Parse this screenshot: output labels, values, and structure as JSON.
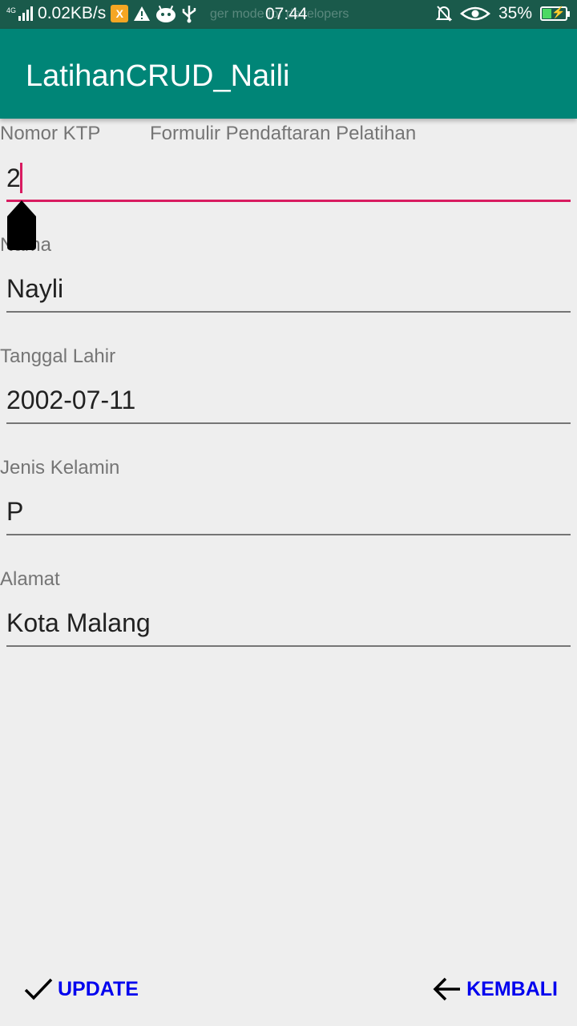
{
  "status_bar": {
    "network_type": "4G",
    "speed": "0.02KB/s",
    "ghost_text": "ger mode for developers",
    "time": "07:44",
    "battery": "35%",
    "battery_level": 0.35
  },
  "app_bar": {
    "title": "LatihanCRUD_Naili"
  },
  "form": {
    "title": "Formulir Pendaftaran Pelatihan",
    "fields": [
      {
        "label": "Nomor KTP",
        "value": "2"
      },
      {
        "label": "Nama",
        "value": "Nayli"
      },
      {
        "label": "Tanggal Lahir",
        "value": "2002-07-11"
      },
      {
        "label": "Jenis Kelamin",
        "value": "P"
      },
      {
        "label": "Alamat",
        "value": "Kota Malang"
      }
    ]
  },
  "buttons": {
    "update": {
      "label": "UPDATE",
      "icon": "check-icon"
    },
    "back": {
      "label": "KEMBALI",
      "icon": "arrow-left-icon"
    }
  },
  "colors": {
    "primary": "#008577",
    "primary_dark": "#1a5a4b",
    "accent": "#d81b60",
    "button_text": "#0000ee"
  }
}
